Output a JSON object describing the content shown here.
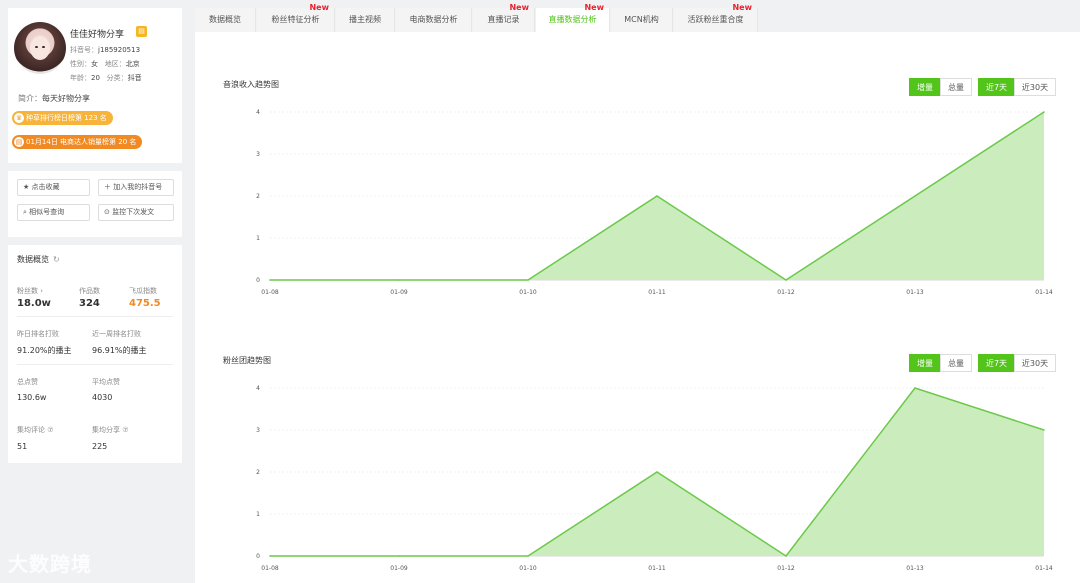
{
  "profile": {
    "nickname": "佳佳好物分享",
    "douyin_label": "抖音号：",
    "douyin_id": "j185920513",
    "gender_label": "性别：",
    "gender": "女",
    "region_label": "地区：",
    "region": "北京",
    "age_label": "年龄：",
    "age": "20",
    "category_label": "分类：",
    "category": "抖音",
    "bio_label": "简介：",
    "bio": "每天好物分享",
    "rank_pill_1": "种草排行榜日榜第 123 名",
    "rank_pill_2": "01月14日 电商达人销量榜第 20 名"
  },
  "actions": {
    "favorite": "★ 点击收藏",
    "add_account": "＋ 加入我的抖音号",
    "similar": "⌕ 相似号查询",
    "monitor": "⊙ 监控下次发文"
  },
  "overview": {
    "title": "数据概览",
    "fans_label": "粉丝数 ›",
    "fans_value": "18.0w",
    "works_label": "作品数",
    "works_value": "324",
    "index_label": "飞瓜指数",
    "index_value": "475.5",
    "yesterday_rank_label": "昨日排名打败",
    "yesterday_rank_value": "91.20%的播主",
    "week_rank_label": "近一周排名打败",
    "week_rank_value": "96.91%的播主",
    "total_likes_label": "总点赞",
    "total_likes_value": "130.6w",
    "avg_likes_label": "平均点赞",
    "avg_likes_value": "4030",
    "avg_comments_label": "集均评论 ⑦",
    "avg_comments_value": "51",
    "avg_shares_label": "集均分享 ⑦",
    "avg_shares_value": "225"
  },
  "tabs": [
    {
      "label": "数据概览",
      "new": ""
    },
    {
      "label": "粉丝特征分析",
      "new": "New"
    },
    {
      "label": "播主视频",
      "new": ""
    },
    {
      "label": "电商数据分析",
      "new": ""
    },
    {
      "label": "直播记录",
      "new": "New"
    },
    {
      "label": "直播数据分析",
      "new": "New"
    },
    {
      "label": "MCN机构",
      "new": ""
    },
    {
      "label": "活跃粉丝重合度",
      "new": "New"
    }
  ],
  "toggles": {
    "increment": "增量",
    "total": "总量",
    "last7": "近7天",
    "last30": "近30天"
  },
  "colors": {
    "accent": "#52c41a",
    "area_fill": "#c8ebb8",
    "line": "#6cc94a",
    "orange": "#f28a24",
    "new_badge": "#e8232f"
  },
  "chart_data": [
    {
      "type": "area",
      "title": "音浪收入趋势图",
      "x": [
        "01-08",
        "01-09",
        "01-10",
        "01-11",
        "01-12",
        "01-13",
        "01-14"
      ],
      "values": [
        0,
        0,
        0,
        2,
        0,
        2,
        4
      ],
      "yticks": [
        "0",
        "1",
        "2",
        "3",
        "4"
      ],
      "ylim": [
        0,
        4
      ],
      "grid": true
    },
    {
      "type": "area",
      "title": "粉丝团趋势图",
      "x": [
        "01-08",
        "01-09",
        "01-10",
        "01-11",
        "01-12",
        "01-13",
        "01-14"
      ],
      "values": [
        0,
        0,
        0,
        2,
        0,
        4,
        3
      ],
      "yticks": [
        "0",
        "1",
        "2",
        "3",
        "4"
      ],
      "ylim": [
        0,
        4
      ],
      "grid": true
    }
  ],
  "watermark": "大数跨境"
}
